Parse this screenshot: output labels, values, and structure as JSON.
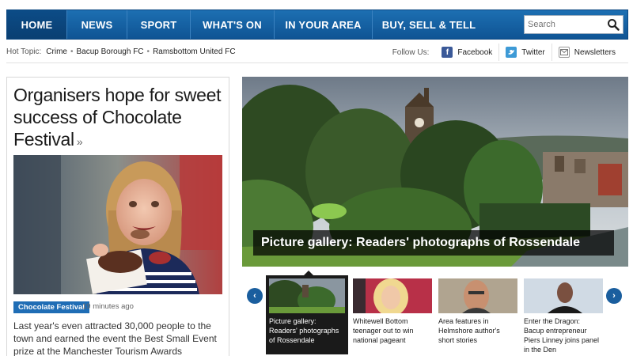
{
  "nav": {
    "items": [
      {
        "label": "HOME"
      },
      {
        "label": "NEWS"
      },
      {
        "label": "SPORT"
      },
      {
        "label": "WHAT'S ON"
      },
      {
        "label": "IN YOUR AREA"
      },
      {
        "label": "BUY, SELL & TELL"
      }
    ],
    "active_index": 0,
    "search_placeholder": "Search",
    "search_icon": "magnifier-icon"
  },
  "hot_topics": {
    "label": "Hot Topic:",
    "links": [
      "Crime",
      "Bacup Borough FC",
      "Ramsbottom United FC"
    ],
    "separator": "•"
  },
  "follow": {
    "label": "Follow Us:",
    "facebook": "Facebook",
    "twitter": "Twitter",
    "newsletters": "Newsletters"
  },
  "lead_story": {
    "title": "Organisers hope for sweet success of Chocolate Festival",
    "arrow": "»",
    "tag": "Chocolate Festival",
    "time": "19 minutes ago",
    "summary": "Last year's even attracted 30,000 people to the town and earned the event the Best Small Event prize at the Manchester Tourism Awards"
  },
  "hero": {
    "caption": "Picture gallery: Readers' photographs of Rossendale"
  },
  "carousel": {
    "prev": "‹",
    "next": "›",
    "items": [
      {
        "caption": "Picture gallery: Readers' photographs of Rossendale"
      },
      {
        "caption": "Whitewell Bottom teenager out to win national pageant"
      },
      {
        "caption": "Area features in Helmshore author's short stories"
      },
      {
        "caption": "Enter the Dragon: Bacup entrepreneur Piers Linney joins panel in the Den"
      }
    ]
  },
  "colors": {
    "nav_blue": "#1463a8",
    "tag_blue": "#1f6db5",
    "caption_bg": "#000000"
  }
}
